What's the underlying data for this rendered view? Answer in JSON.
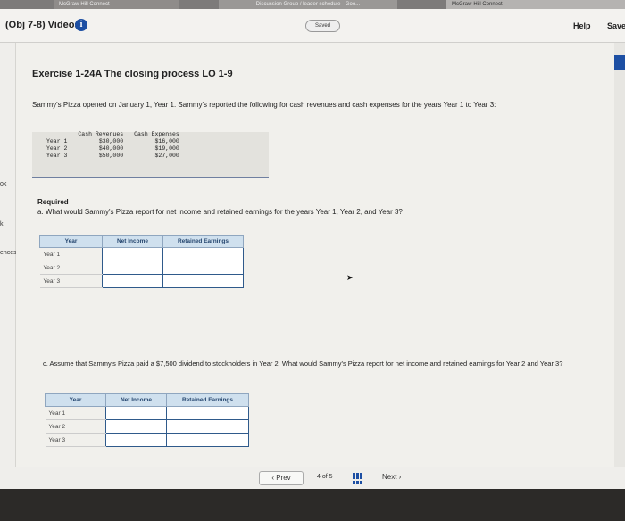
{
  "browser_tabs": [
    "McGraw-Hill Connect",
    "Discussion Group / leader schedule - Goo...",
    "McGraw-Hill Connect"
  ],
  "header": {
    "breadcrumb": "(Obj 7-8) Videos",
    "info_icon": "i",
    "saved_label": "Saved",
    "help_label": "Help",
    "save_label": "Save"
  },
  "sidebar": {
    "marks": [
      "ok",
      "k",
      "ences"
    ]
  },
  "exercise": {
    "title": "Exercise 1-24A The closing process LO 1-9",
    "intro": "Sammy's Pizza opened on January 1, Year 1. Sammy's reported the following for cash revenues and cash expenses for the years Year 1 to Year 3:",
    "given_headers": [
      "Cash Revenues",
      "Cash Expenses"
    ],
    "given_rows": [
      {
        "year": "Year 1",
        "rev": "$30,000",
        "exp": "$16,000"
      },
      {
        "year": "Year 2",
        "rev": "$40,000",
        "exp": "$19,000"
      },
      {
        "year": "Year 3",
        "rev": "$50,000",
        "exp": "$27,000"
      }
    ],
    "required_label": "Required",
    "question_a": "a. What would Sammy's Pizza report for net income and retained earnings for the years Year 1, Year 2, and Year 3?",
    "table_a": {
      "headers": [
        "Year",
        "Net Income",
        "Retained Earnings"
      ],
      "rows": [
        "Year 1",
        "Year 2",
        "Year 3"
      ]
    },
    "question_c": "c. Assume that Sammy's Pizza paid a $7,500 dividend to stockholders in Year 2. What would Sammy's Pizza report for net income and retained earnings for Year 2 and Year 3?",
    "table_c": {
      "headers": [
        "Year",
        "Net Income",
        "Retained Earnings"
      ],
      "rows": [
        "Year 1",
        "Year 2",
        "Year 3"
      ]
    }
  },
  "nav": {
    "prev_label": "Prev",
    "page_current": "4",
    "page_of": "of",
    "page_total": "5",
    "next_label": "Next"
  },
  "colors": {
    "accent": "#1d4fa3",
    "table_header": "#cfe0ee",
    "red_tab": "#d0342c"
  }
}
